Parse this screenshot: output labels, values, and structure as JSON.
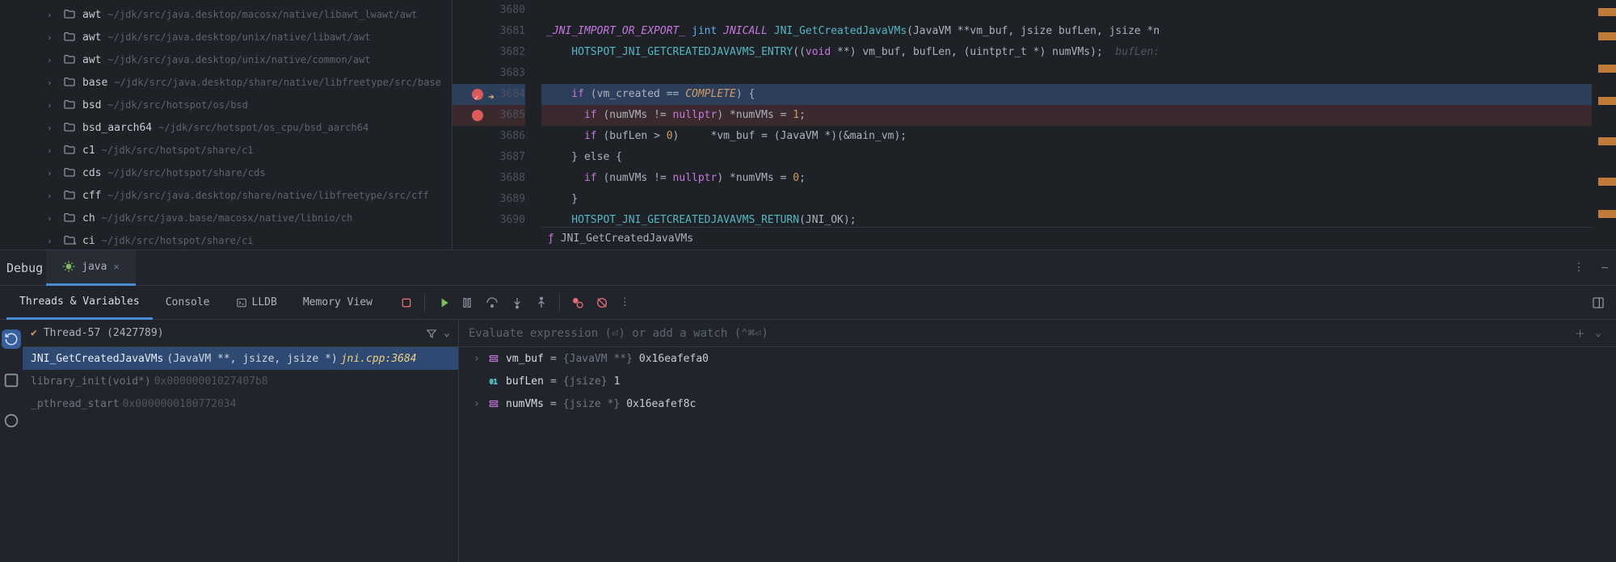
{
  "tree": [
    {
      "name": "awt",
      "path": "~/jdk/src/java.desktop/macosx/native/libawt_lwawt/awt"
    },
    {
      "name": "awt",
      "path": "~/jdk/src/java.desktop/unix/native/libawt/awt"
    },
    {
      "name": "awt",
      "path": "~/jdk/src/java.desktop/unix/native/common/awt"
    },
    {
      "name": "base",
      "path": "~/jdk/src/java.desktop/share/native/libfreetype/src/base"
    },
    {
      "name": "bsd",
      "path": "~/jdk/src/hotspot/os/bsd"
    },
    {
      "name": "bsd_aarch64",
      "path": "~/jdk/src/hotspot/os_cpu/bsd_aarch64"
    },
    {
      "name": "c1",
      "path": "~/jdk/src/hotspot/share/c1"
    },
    {
      "name": "cds",
      "path": "~/jdk/src/hotspot/share/cds"
    },
    {
      "name": "cff",
      "path": "~/jdk/src/java.desktop/share/native/libfreetype/src/cff"
    },
    {
      "name": "ch",
      "path": "~/jdk/src/java.base/macosx/native/libnio/ch"
    },
    {
      "name": "ci",
      "path": "~/jdk/src/hotspot/share/ci"
    }
  ],
  "editor": {
    "lines": [
      "3680",
      "3681",
      "3682",
      "3683",
      "3684",
      "3685",
      "3686",
      "3687",
      "3688",
      "3689",
      "3690"
    ]
  },
  "code": {
    "l3680": "",
    "l3681a": "_JNI_IMPORT_OR_EXPORT_",
    "l3681b": " jint ",
    "l3681c": "JNICALL",
    "l3681d": " JNI_GetCreatedJavaVMs",
    "l3681e": "(JavaVM **vm_buf, jsize bufLen, jsize *n",
    "l3682a": "    HOTSPOT_JNI_GETCREATEDJAVAVMS_ENTRY",
    "l3682b": "((",
    "l3682c": "void",
    "l3682d": " **) vm_buf, bufLen, (uintptr_t *) numVMs);",
    "l3682hint": "  bufLen:",
    "l3683": "",
    "l3684a": "    if",
    "l3684b": " (vm_created == ",
    "l3684c": "COMPLETE",
    "l3684d": ") {",
    "l3685a": "      if",
    "l3685b": " (numVMs != ",
    "l3685c": "nullptr",
    "l3685d": ") *numVMs = ",
    "l3685e": "1",
    "l3685f": ";",
    "l3686a": "      if",
    "l3686b": " (bufLen > ",
    "l3686c": "0",
    "l3686d": ")     *vm_buf = (JavaVM *)(&main_vm);",
    "l3687": "    } else {",
    "l3688a": "      if",
    "l3688b": " (numVMs != ",
    "l3688c": "nullptr",
    "l3688d": ") *numVMs = ",
    "l3688e": "0",
    "l3688f": ";",
    "l3689": "    }",
    "l3690a": "    HOTSPOT_JNI_GETCREATEDJAVAVMS_RETURN",
    "l3690b": "(JNI_OK);"
  },
  "breadcrumb": {
    "func": "JNI_GetCreatedJavaVMs"
  },
  "debug": {
    "title": "Debug",
    "run_config": "java",
    "tabs": {
      "threads": "Threads & Variables",
      "console": "Console",
      "lldb": "LLDB",
      "memory": "Memory View"
    },
    "thread": "Thread-57 (2427789)",
    "frames": [
      {
        "fn": "JNI_GetCreatedJavaVMs",
        "args": "(JavaVM **, jsize, jsize *) ",
        "loc": "jni.cpp:3684",
        "sel": true
      },
      {
        "fn": "library_init(void*)",
        "addr": " 0x00000001027407b8",
        "dim": true
      },
      {
        "fn": "_pthread_start",
        "addr": " 0x0000000180772034",
        "dim": true
      }
    ],
    "eval_placeholder": "Evaluate expression (⏎) or add a watch (⌃⌘⏎)",
    "vars": [
      {
        "expand": true,
        "icon": "obj",
        "name": "vm_buf",
        "eq": " = ",
        "type": "{JavaVM **}",
        "val": " 0x16eafefa0"
      },
      {
        "expand": false,
        "icon": "prim",
        "name": "bufLen",
        "eq": " = ",
        "type": "{jsize}",
        "val": " 1"
      },
      {
        "expand": true,
        "icon": "obj",
        "name": "numVMs",
        "eq": " = ",
        "type": "{jsize *}",
        "val": " 0x16eafef8c"
      }
    ]
  }
}
